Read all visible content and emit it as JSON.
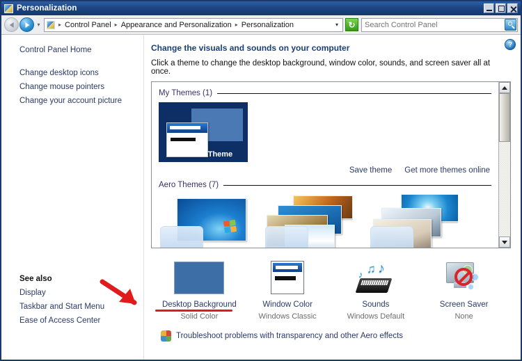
{
  "window": {
    "title": "Personalization",
    "icon": "personalization-icon",
    "buttons": {
      "minimize": "minimize",
      "maximize": "maximize",
      "close": "close"
    }
  },
  "addressbar": {
    "back": "back-icon",
    "forward": "forward-icon",
    "recent_caret": "▾",
    "crumbs": [
      "Control Panel",
      "Appearance and Personalization",
      "Personalization"
    ],
    "separator": "▸",
    "dropdown_caret": "▾",
    "refresh_label": "↻",
    "search": {
      "placeholder": "Search Control Panel",
      "value": ""
    }
  },
  "sidebar": {
    "home": "Control Panel Home",
    "items": [
      {
        "label": "Change desktop icons"
      },
      {
        "label": "Change mouse pointers"
      },
      {
        "label": "Change your account picture"
      }
    ],
    "see_also": {
      "heading": "See also",
      "items": [
        {
          "label": "Display"
        },
        {
          "label": "Taskbar and Start Menu"
        },
        {
          "label": "Ease of Access Center"
        }
      ]
    }
  },
  "main": {
    "help": "?",
    "heading": "Change the visuals and sounds on your computer",
    "subheading": "Click a theme to change the desktop background, window color, sounds, and screen saver all at once.",
    "groups": [
      {
        "label": "My Themes (1)",
        "themes": [
          {
            "name": "Unsaved Theme",
            "selected": true
          }
        ]
      },
      {
        "label": "Aero Themes (7)",
        "themes": [
          {
            "name": ""
          },
          {
            "name": ""
          },
          {
            "name": ""
          }
        ]
      }
    ],
    "theme_links": [
      {
        "label": "Save theme"
      },
      {
        "label": "Get more themes online"
      }
    ],
    "options": [
      {
        "name": "Desktop Background",
        "value": "Solid Color",
        "icon": "desktop-background-swatch",
        "annotated": true
      },
      {
        "name": "Window Color",
        "value": "Windows Classic",
        "icon": "window-color-swatch",
        "annotated": false
      },
      {
        "name": "Sounds",
        "value": "Windows Default",
        "icon": "sounds-icon",
        "annotated": false
      },
      {
        "name": "Screen Saver",
        "value": "None",
        "icon": "screen-saver-icon",
        "annotated": false
      }
    ],
    "troubleshoot": "Troubleshoot problems with transparency and other Aero effects"
  },
  "colors": {
    "title_bar": "#1c4380",
    "window_border": "#1b3a6b",
    "link": "#2a3a66",
    "heading": "#1a3f77",
    "desktop_swatch": "#3d6ea5",
    "annotation": "#e01b1b",
    "theme_selected_bg": "#0d2f66"
  }
}
